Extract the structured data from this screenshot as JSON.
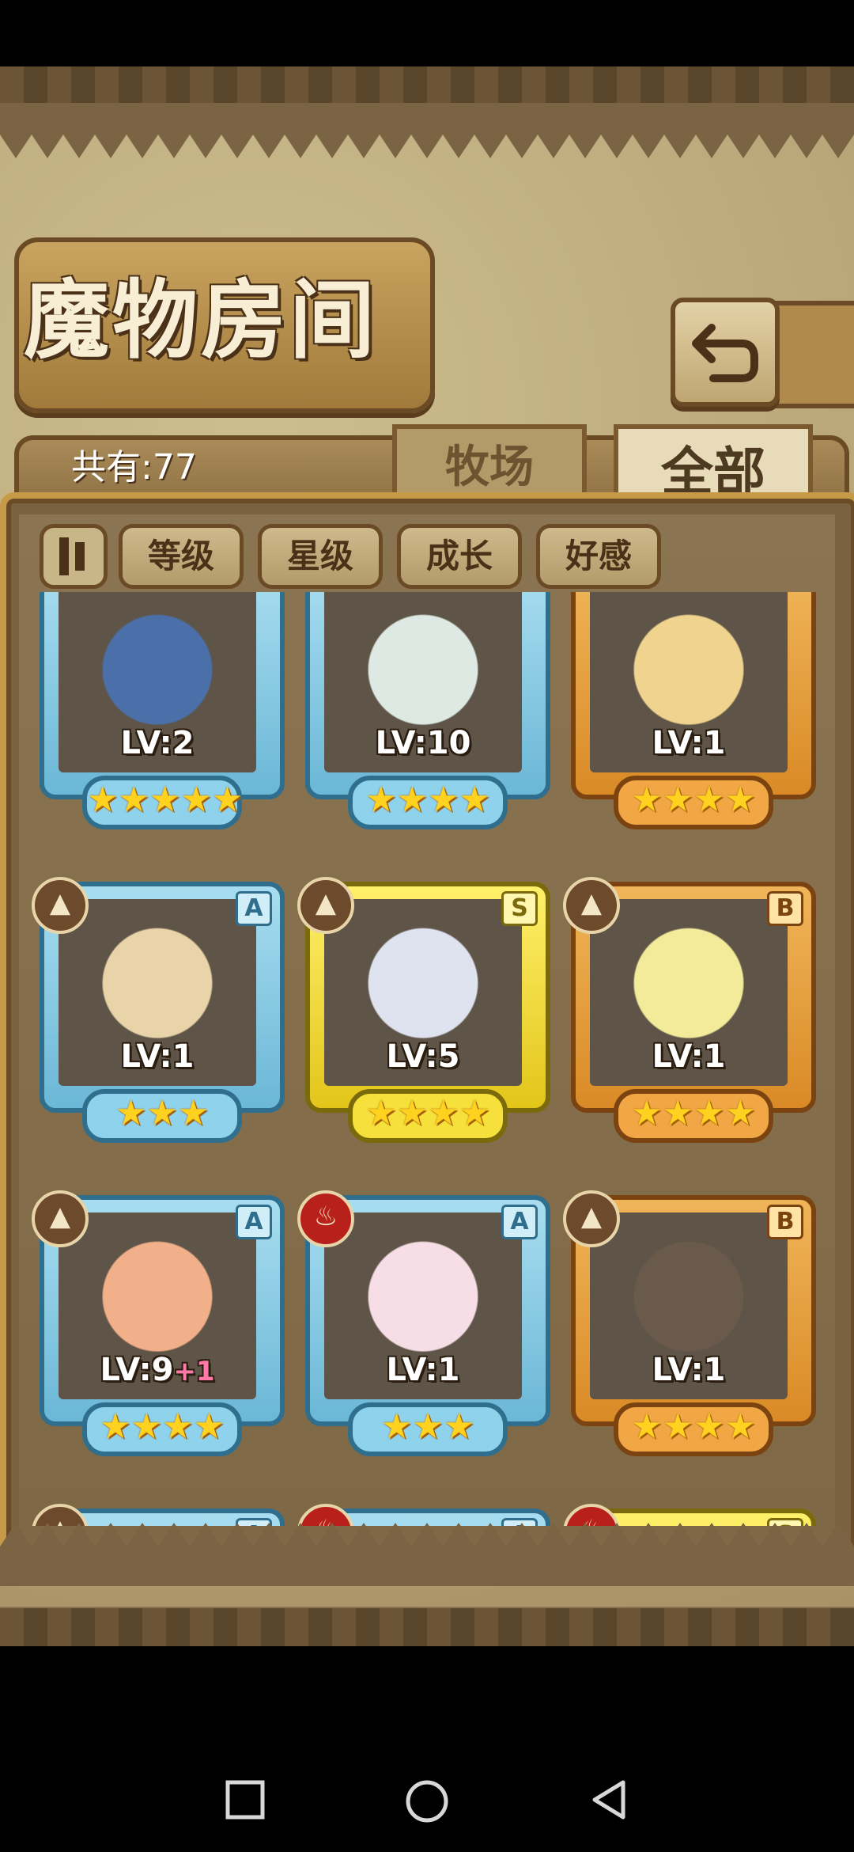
{
  "header": {
    "title": "魔物房间",
    "back_icon": "return-arrow-icon"
  },
  "tabs": {
    "count_label": "共有:77",
    "ranch": "牧场",
    "all": "全部"
  },
  "filters": {
    "toggle_icon": "sort-toggle-icon",
    "buttons": [
      "等级",
      "星级",
      "成长",
      "好感"
    ]
  },
  "monsters": [
    {
      "level": "LV:2",
      "plus": "",
      "stars": "★★★★★",
      "frame": "blue",
      "element": "",
      "rank": ""
    },
    {
      "level": "LV:10",
      "plus": "",
      "stars": "★★★★",
      "frame": "blue",
      "element": "",
      "rank": ""
    },
    {
      "level": "LV:1",
      "plus": "",
      "stars": "★★★★",
      "frame": "orange",
      "element": "",
      "rank": ""
    },
    {
      "level": "LV:1",
      "plus": "",
      "stars": "★★★",
      "frame": "blue",
      "element": "earth",
      "rank": "A"
    },
    {
      "level": "LV:5",
      "plus": "",
      "stars": "★★★★",
      "frame": "gold",
      "element": "earth",
      "rank": "S"
    },
    {
      "level": "LV:1",
      "plus": "",
      "stars": "★★★★",
      "frame": "orange",
      "element": "earth",
      "rank": "B"
    },
    {
      "level": "LV:9",
      "plus": "+1",
      "stars": "★★★★",
      "frame": "blue",
      "element": "earth",
      "rank": "A"
    },
    {
      "level": "LV:1",
      "plus": "",
      "stars": "★★★",
      "frame": "blue",
      "element": "fire",
      "rank": "A"
    },
    {
      "level": "LV:1",
      "plus": "",
      "stars": "★★★★",
      "frame": "orange",
      "element": "earth",
      "rank": "B"
    },
    {
      "level": "",
      "plus": "",
      "stars": "",
      "frame": "blue",
      "element": "earth",
      "rank": "A"
    },
    {
      "level": "",
      "plus": "",
      "stars": "",
      "frame": "blue",
      "element": "fire",
      "rank": "A"
    },
    {
      "level": "",
      "plus": "",
      "stars": "",
      "frame": "gold",
      "element": "fire",
      "rank": "S"
    }
  ],
  "colors": {
    "portraits": [
      "#4b6fa8",
      "#dfe9e4",
      "#efd38f",
      "#e9d3a8",
      "#dfe3ef",
      "#f3ea9a",
      "#f1b08a",
      "#f6dde6",
      "#6a5a4c",
      "#4a5a7a",
      "#6a4a7a",
      "#e6a0b0"
    ]
  },
  "navigation": {
    "recent_icon": "square-icon",
    "home_icon": "circle-icon",
    "back_icon": "triangle-back-icon"
  }
}
